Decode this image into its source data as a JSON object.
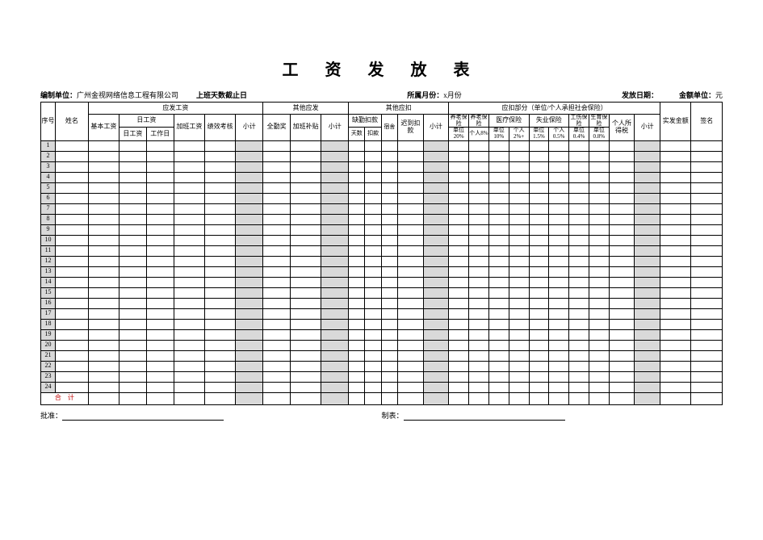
{
  "title": "工 资 发 放 表",
  "meta": {
    "company_label": "编制单位：",
    "company_value": "广州金视网络信息工程有限公司",
    "cutoff_label": "上班天数截止日",
    "month_label": "所属月份：",
    "month_value": "x月份",
    "issue_label": "发放日期：",
    "unit_label": "金额单位：",
    "unit_value": "元"
  },
  "hdr": {
    "seq": "序号",
    "name": "姓名",
    "due_group": "应发工资",
    "other_due_group": "其他应发",
    "other_deduct_group": "其他应扣",
    "deduct_group": "应扣部分（单位/个人承担社会保险）",
    "basic": "基本工资",
    "day_group": "日工资",
    "day_wage": "日工资",
    "work_day": "工作日",
    "ot": "加班工资",
    "perf": "绩效考核",
    "subtotal": "小计",
    "attend_bonus": "全勤奖",
    "ot_allow": "加班补贴",
    "absent_group": "缺勤扣款",
    "absent_days": "天数",
    "absent_amt": "扣款",
    "dorm": "宿舍",
    "late": "迟到扣款",
    "pension_e": "养老保险",
    "pension_p": "养老保险",
    "med": "医疗保险",
    "unemp": "失业保险",
    "injury": "工伤保险",
    "birth": "生育保险",
    "tax": "个人所得税",
    "emp20": "单位20%",
    "per8": "个人8%",
    "emp10": "单位10%",
    "per2": "个人2%+",
    "emp15": "单位1.5%",
    "per05": "个人0.5%",
    "emp04": "单位0.4%",
    "emp08": "单位0.8%",
    "net": "实发金额",
    "sign": "签名",
    "total": "合　计"
  },
  "rows": [
    1,
    2,
    3,
    4,
    5,
    6,
    7,
    8,
    9,
    10,
    11,
    12,
    13,
    14,
    15,
    16,
    17,
    18,
    19,
    20,
    21,
    22,
    23,
    24
  ],
  "footer": {
    "approve": "批准：",
    "maker": "制表："
  }
}
